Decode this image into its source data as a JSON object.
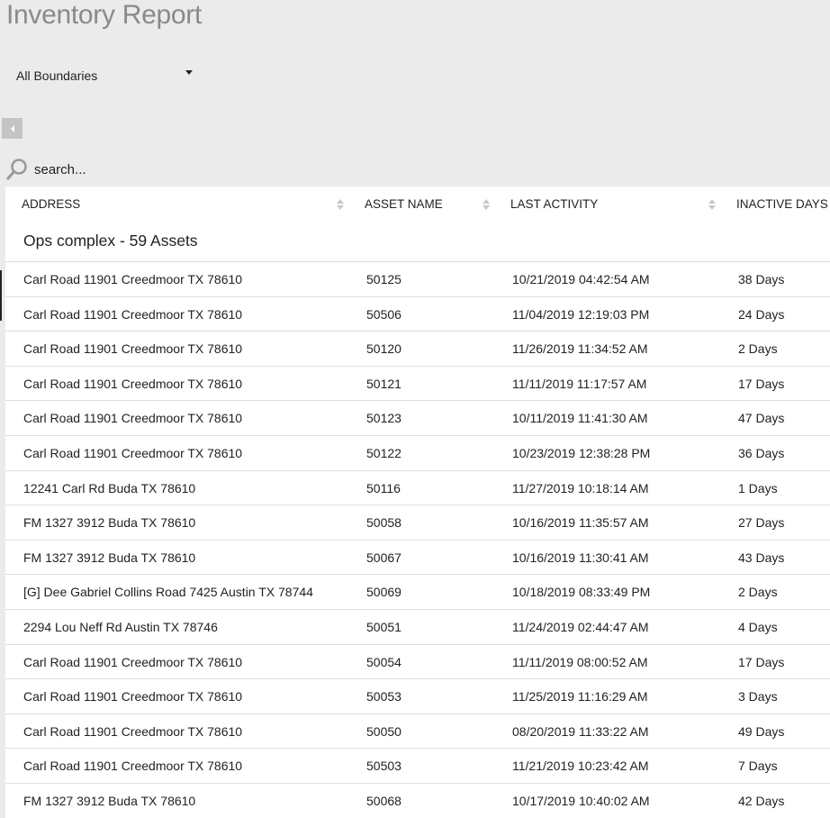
{
  "page": {
    "title": "Inventory Report",
    "boundary_select": {
      "value": "All Boundaries"
    },
    "search": {
      "placeholder": "search..."
    }
  },
  "table": {
    "columns": [
      "ADDRESS",
      "ASSET NAME",
      "LAST ACTIVITY",
      "INACTIVE DAYS"
    ],
    "group_label": "Ops complex - 59 Assets",
    "rows": [
      [
        "Carl Road 11901 Creedmoor TX 78610",
        "50125",
        "10/21/2019 04:42:54 AM",
        "38 Days"
      ],
      [
        "Carl Road 11901 Creedmoor TX 78610",
        "50506",
        "11/04/2019 12:19:03 PM",
        "24 Days"
      ],
      [
        "Carl Road 11901 Creedmoor TX 78610",
        "50120",
        "11/26/2019 11:34:52 AM",
        "2 Days"
      ],
      [
        "Carl Road 11901 Creedmoor TX 78610",
        "50121",
        "11/11/2019 11:17:57 AM",
        "17 Days"
      ],
      [
        "Carl Road 11901 Creedmoor TX 78610",
        "50123",
        "10/11/2019 11:41:30 AM",
        "47 Days"
      ],
      [
        "Carl Road 11901 Creedmoor TX 78610",
        "50122",
        "10/23/2019 12:38:28 PM",
        "36 Days"
      ],
      [
        "12241 Carl Rd Buda TX 78610",
        "50116",
        "11/27/2019 10:18:14 AM",
        "1 Days"
      ],
      [
        "FM 1327 3912 Buda TX 78610",
        "50058",
        "10/16/2019 11:35:57 AM",
        "27 Days"
      ],
      [
        "FM 1327 3912 Buda TX 78610",
        "50067",
        "10/16/2019 11:30:41 AM",
        "43 Days"
      ],
      [
        "[G] Dee Gabriel Collins Road 7425 Austin TX 78744",
        "50069",
        "10/18/2019 08:33:49 PM",
        "2 Days"
      ],
      [
        "2294 Lou Neff Rd Austin TX 78746",
        "50051",
        "11/24/2019 02:44:47 AM",
        "4 Days"
      ],
      [
        "Carl Road 11901 Creedmoor TX 78610",
        "50054",
        "11/11/2019 08:00:52 AM",
        "17 Days"
      ],
      [
        "Carl Road 11901 Creedmoor TX 78610",
        "50053",
        "11/25/2019 11:16:29 AM",
        "3 Days"
      ],
      [
        "Carl Road 11901 Creedmoor TX 78610",
        "50050",
        "08/20/2019 11:33:22 AM",
        "49 Days"
      ],
      [
        "Carl Road 11901 Creedmoor TX 78610",
        "50503",
        "11/21/2019 10:23:42 AM",
        "7 Days"
      ],
      [
        "FM 1327 3912 Buda TX 78610",
        "50068",
        "10/17/2019 10:40:02 AM",
        "42 Days"
      ]
    ]
  },
  "icons": {
    "search": "search-icon",
    "collapse": "chevron-left-icon",
    "dropdown": "caret-down-icon",
    "sort": "sort-icon"
  },
  "colors": {
    "background": "#ebebeb",
    "title": "#8a8a8a",
    "table_bg": "#ffffff",
    "row_divider": "#dedede"
  }
}
